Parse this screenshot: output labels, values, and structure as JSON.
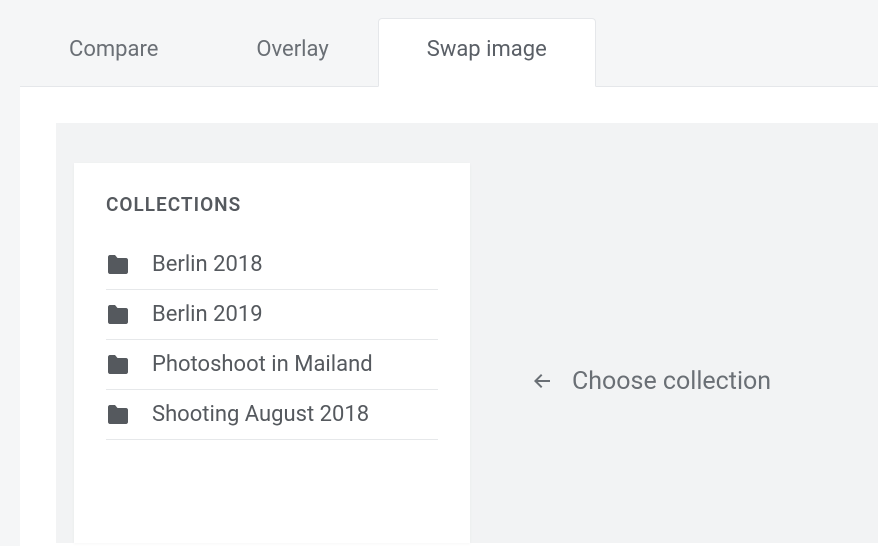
{
  "tabs": [
    {
      "label": "Compare",
      "active": false
    },
    {
      "label": "Overlay",
      "active": false
    },
    {
      "label": "Swap image",
      "active": true
    }
  ],
  "collections": {
    "heading": "COLLECTIONS",
    "items": [
      {
        "label": "Berlin 2018"
      },
      {
        "label": "Berlin 2019"
      },
      {
        "label": "Photoshoot in Mailand"
      },
      {
        "label": "Shooting August 2018"
      }
    ]
  },
  "hint": {
    "text": "Choose collection"
  }
}
